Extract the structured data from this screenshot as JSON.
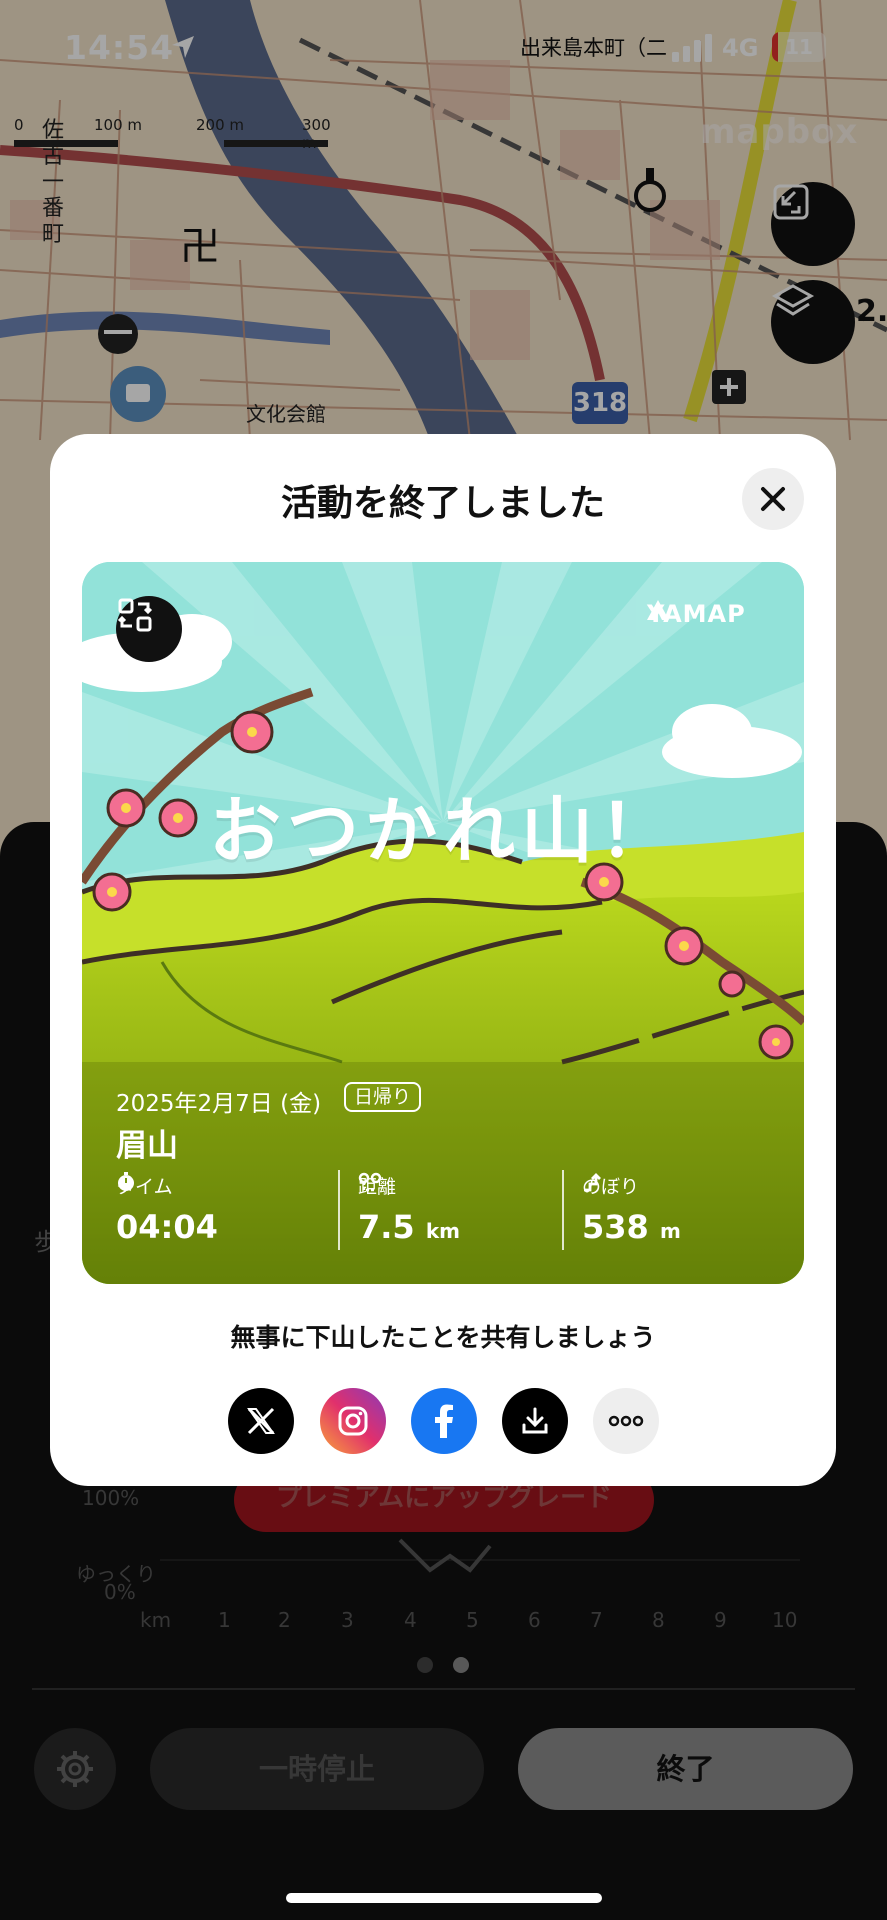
{
  "status_bar": {
    "time": "14:54",
    "carrier": "出来島本町（二",
    "network": "4G",
    "battery": "11"
  },
  "map": {
    "scale_labels": [
      "0",
      "100 m",
      "200 m",
      "300 m"
    ],
    "place_labels": [
      "佐古一番町",
      "文化会館"
    ],
    "route_number": "318",
    "attribution": "mapbox",
    "side_number": "2."
  },
  "modal": {
    "title": "活動を終了しました",
    "card": {
      "brand": "YAMAP",
      "headline": "おつかれ山！",
      "date": "2025年2月7日 (金)",
      "trip_badge": "日帰り",
      "mountain": "眉山",
      "stats": [
        {
          "label": "タイム",
          "value": "04:04",
          "unit": "",
          "icon": "stopwatch-icon"
        },
        {
          "label": "距離",
          "value": "7.5",
          "unit": "km",
          "icon": "distance-pin-icon"
        },
        {
          "label": "のぼり",
          "value": "538",
          "unit": "m",
          "icon": "ascent-icon"
        }
      ]
    },
    "share_prompt": "無事に下山したことを共有しましょう",
    "share_buttons": [
      {
        "name": "x-share-button",
        "icon": "x-logo-icon",
        "color": "#000000"
      },
      {
        "name": "instagram-share-button",
        "icon": "instagram-logo-icon",
        "color": "#e1306c"
      },
      {
        "name": "facebook-share-button",
        "icon": "facebook-logo-icon",
        "color": "#1877f2"
      },
      {
        "name": "download-button",
        "icon": "download-icon",
        "color": "#000000"
      },
      {
        "name": "more-share-button",
        "icon": "more-dots-icon",
        "color": "#eeeeee"
      }
    ]
  },
  "sheet": {
    "partial_label": "歩",
    "upgrade_label": "プレミアムにアップグレード",
    "chart": {
      "y_labels": [
        "100%",
        "ゆっくり",
        "0%"
      ],
      "x_unit": "km",
      "x_ticks": [
        "1",
        "2",
        "3",
        "4",
        "5",
        "6",
        "7",
        "8",
        "9",
        "10"
      ]
    },
    "page_dots": 2,
    "active_dot": 1,
    "pause_label": "一時停止",
    "finish_label": "終了"
  },
  "colors": {
    "accent": "#a0141e",
    "card_sky": "#8fe0d8",
    "card_ground": "#9bc417"
  }
}
